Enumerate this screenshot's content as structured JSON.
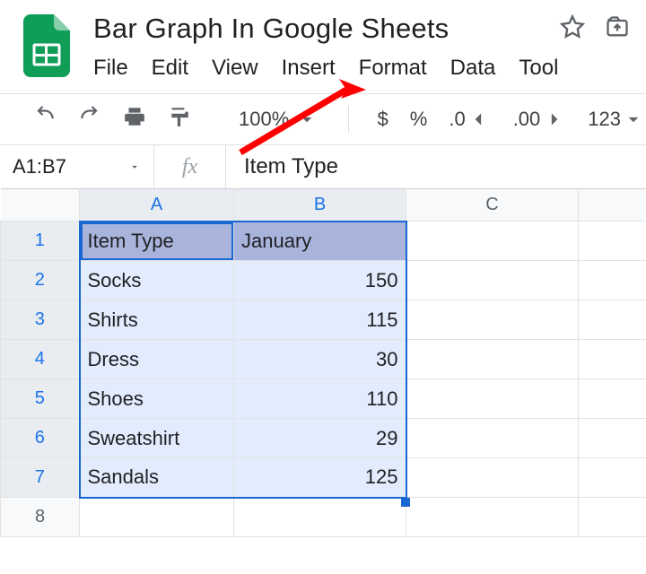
{
  "doc": {
    "title": "Bar Graph In Google Sheets"
  },
  "menu": {
    "file": "File",
    "edit": "Edit",
    "view": "View",
    "insert": "Insert",
    "format": "Format",
    "data": "Data",
    "tools": "Tool"
  },
  "toolbar": {
    "zoom": "100%",
    "currency": "$",
    "percent": "%",
    "dec_dec": ".0",
    "inc_dec": ".00",
    "numfmt": "123"
  },
  "fx": {
    "namebox": "A1:B7",
    "symbol": "fx",
    "value": "Item Type"
  },
  "grid": {
    "cols": [
      "A",
      "B",
      "C"
    ],
    "rows": [
      "1",
      "2",
      "3",
      "4",
      "5",
      "6",
      "7",
      "8"
    ],
    "headers": {
      "a": "Item Type",
      "b": "January"
    },
    "data": [
      {
        "a": "Socks",
        "b": "150"
      },
      {
        "a": "Shirts",
        "b": "115"
      },
      {
        "a": "Dress",
        "b": "30"
      },
      {
        "a": "Shoes",
        "b": "110"
      },
      {
        "a": "Sweatshirt",
        "b": "29"
      },
      {
        "a": "Sandals",
        "b": "125"
      }
    ]
  }
}
